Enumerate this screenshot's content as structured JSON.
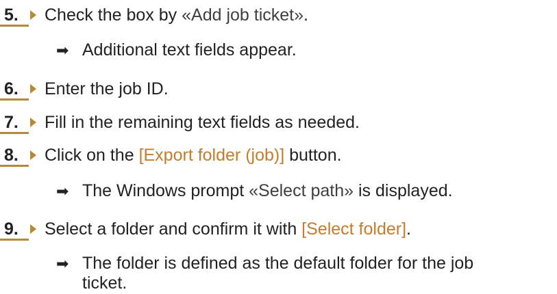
{
  "steps": [
    {
      "num": "5.",
      "pre": "Check the box by ",
      "hl": "«Add job ticket»",
      "post": "."
    },
    {
      "result": "Additional text fields appear."
    },
    {
      "num": "6.",
      "text": "Enter the job ID."
    },
    {
      "num": "7.",
      "text": "Fill in the remaining text fields as needed."
    },
    {
      "num": "8.",
      "pre": "Click on the ",
      "hl": "[Export folder (job)]",
      "post": " button."
    },
    {
      "result_pre": "The Windows prompt ",
      "result_hl": "«Select path»",
      "result_post": " is displayed."
    },
    {
      "num": "9.",
      "pre": "Select a folder and confirm it with ",
      "hl": "[Select folder]",
      "post": "."
    },
    {
      "result_line1": "The folder is defined as the default folder for the job",
      "result_line2": "ticket."
    }
  ],
  "colors": {
    "accent": "#b5893a",
    "highlight": "#c47d2c"
  },
  "icons": {
    "step_marker": "step-arrow-icon",
    "result_marker": "right-arrow-icon"
  }
}
